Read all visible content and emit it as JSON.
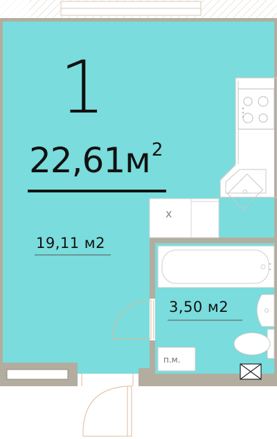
{
  "plan": {
    "rooms_count": "1",
    "total_area": {
      "value": "22,61м",
      "superscript": "2"
    },
    "room_area": "19,11 м2",
    "bathroom_area": "3,50 м2",
    "closet_mark": "х",
    "laundry_mark": "п.м."
  },
  "colors": {
    "floor_fill": "#7adcdc",
    "wall": "#b3ada0",
    "fixture_line": "#c8c8c8",
    "hatch": "#d8cfc0",
    "door_line": "#e2b896",
    "text": "#111111"
  }
}
